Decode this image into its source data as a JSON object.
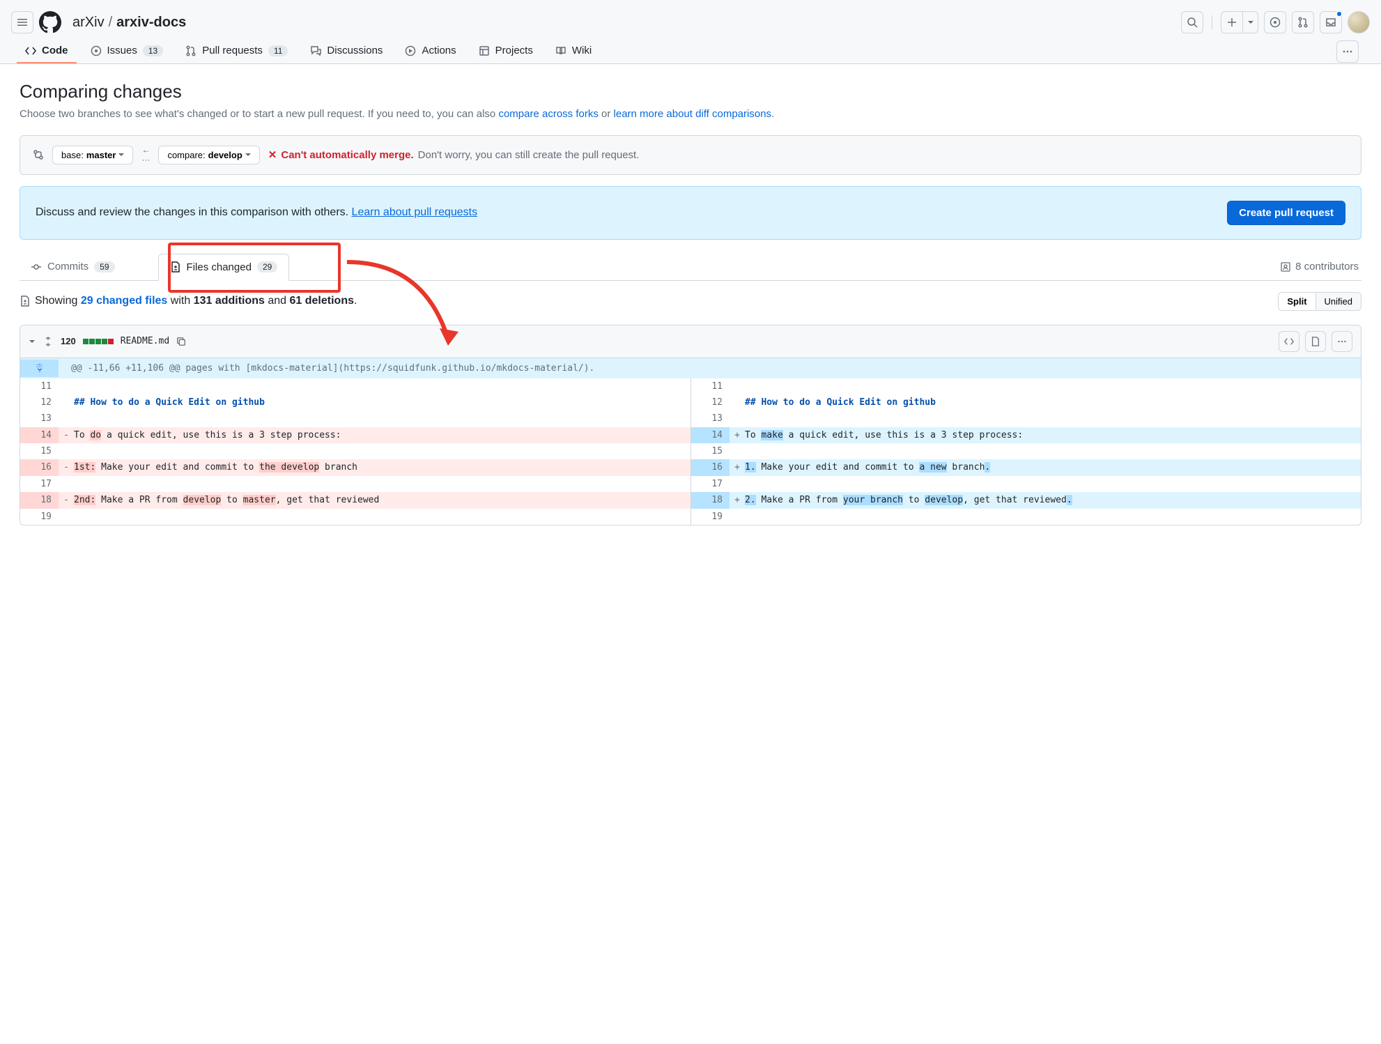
{
  "breadcrumb": {
    "owner": "arXiv",
    "repo": "arxiv-docs"
  },
  "nav": {
    "code": "Code",
    "issues": "Issues",
    "issues_count": "13",
    "prs": "Pull requests",
    "prs_count": "11",
    "discussions": "Discussions",
    "actions": "Actions",
    "projects": "Projects",
    "wiki": "Wiki"
  },
  "page": {
    "title": "Comparing changes",
    "sub_pre": "Choose two branches to see what's changed or to start a new pull request. If you need to, you can also ",
    "sub_link1": "compare across forks",
    "sub_mid": " or ",
    "sub_link2": "learn more about diff comparisons",
    "sub_post": "."
  },
  "branches": {
    "base_label": "base: ",
    "base_val": "master",
    "compare_label": "compare: ",
    "compare_val": "develop"
  },
  "merge": {
    "error": "Can't automatically merge.",
    "rest": "Don't worry, you can still create the pull request."
  },
  "banner": {
    "text": "Discuss and review the changes in this comparison with others. ",
    "link": "Learn about pull requests",
    "button": "Create pull request"
  },
  "ctabs": {
    "commits": "Commits",
    "commits_count": "59",
    "files": "Files changed",
    "files_count": "29",
    "contribs": "8 contributors"
  },
  "summary": {
    "showing": "Showing ",
    "link": "29 changed files",
    "mid1": " with ",
    "add": "131 additions",
    "mid2": " and ",
    "del": "61 deletions",
    "post": ".",
    "split": "Split",
    "unified": "Unified"
  },
  "file": {
    "stat": "120",
    "name": "README.md",
    "hunk": "@@ -11,66 +11,106 @@ pages with [mkdocs-material](https://squidfunk.github.io/mkdocs-material/)."
  },
  "diff": {
    "l11": "11",
    "l12": "12",
    "l13": "13",
    "l14": "14",
    "l15": "15",
    "l16": "16",
    "l17": "17",
    "l18": "18",
    "l19": "19",
    "h2": "## How to do a Quick Edit on github",
    "left14a": "To ",
    "left14w": "do",
    "left14b": " a quick edit, use this is a 3 step process:",
    "right14a": "To ",
    "right14w": "make",
    "right14b": " a quick edit, use this is a 3 step process:",
    "left16a": "1st:",
    "left16b": " Make your edit and commit to ",
    "left16c": "the develop",
    "left16d": " branch",
    "right16a": "1.",
    "right16b": " Make your edit and commit to ",
    "right16c": "a new",
    "right16d": " branch",
    "right16e": ".",
    "left18a": "2nd:",
    "left18b": " Make a PR from ",
    "left18c": "develop",
    "left18d": " to ",
    "left18e": "master",
    "left18f": ", get that reviewed",
    "right18a": "2.",
    "right18b": " Make a PR from ",
    "right18c": "your branch",
    "right18d": " to ",
    "right18e": "develop",
    "right18f": ", get that reviewed",
    "right18g": "."
  }
}
